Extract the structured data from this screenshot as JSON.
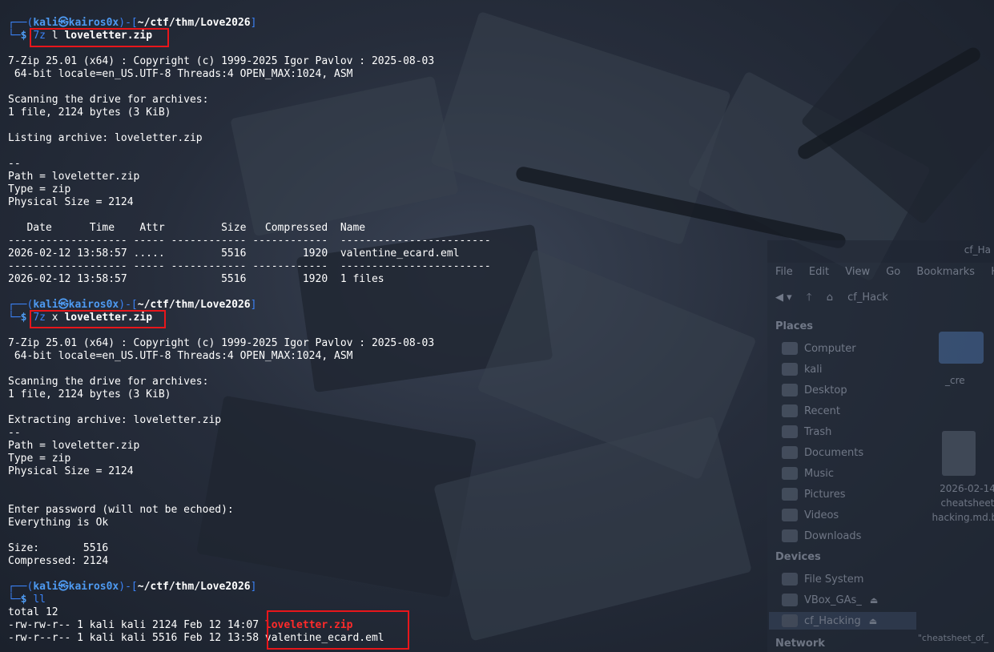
{
  "prompt": {
    "user": "kali",
    "host": "kairos0x",
    "path": "~/ctf/thm/Love2026",
    "symbol": "$"
  },
  "commands": [
    {
      "bin": "7z",
      "args": "l",
      "target": "loveletter.zip"
    },
    {
      "bin": "7z",
      "args": "x",
      "target": "loveletter.zip"
    },
    {
      "bin": "ll"
    }
  ],
  "list_output": {
    "banner": "7-Zip 25.01 (x64) : Copyright (c) 1999-2025 Igor Pavlov : 2025-08-03",
    "banner2": " 64-bit locale=en_US.UTF-8 Threads:4 OPEN_MAX:1024, ASM",
    "scanning": "Scanning the drive for archives:",
    "scan_result": "1 file, 2124 bytes (3 KiB)",
    "listing": "Listing archive: loveletter.zip",
    "sep": "--",
    "path": "Path = loveletter.zip",
    "type": "Type = zip",
    "physical": "Physical Size = 2124",
    "table_header": "   Date      Time    Attr         Size   Compressed  Name",
    "rule": "------------------- ----- ------------ ------------  ------------------------",
    "row": "2026-02-12 13:58:57 .....         5516         1920  valentine_ecard.eml",
    "total": "2026-02-12 13:58:57               5516         1920  1 files"
  },
  "extract_output": {
    "banner": "7-Zip 25.01 (x64) : Copyright (c) 1999-2025 Igor Pavlov : 2025-08-03",
    "banner2": " 64-bit locale=en_US.UTF-8 Threads:4 OPEN_MAX:1024, ASM",
    "scanning": "Scanning the drive for archives:",
    "scan_result": "1 file, 2124 bytes (3 KiB)",
    "extracting": "Extracting archive: loveletter.zip",
    "sep": "--",
    "path": "Path = loveletter.zip",
    "type": "Type = zip",
    "physical": "Physical Size = 2124",
    "password": "Enter password (will not be echoed):",
    "ok": "Everything is Ok",
    "size": "Size:       5516",
    "compressed": "Compressed: 2124"
  },
  "ll_output": {
    "total": "total 12",
    "files": [
      {
        "meta": "-rw-rw-r-- 1 kali kali 2124 Feb 12 14:07 ",
        "name": "loveletter.zip"
      },
      {
        "meta": "-rw-r--r-- 1 kali kali 5516 Feb 12 13:58 ",
        "name": "valentine_ecard.eml"
      }
    ]
  },
  "file_manager": {
    "title": "cf_Ha",
    "menu": [
      "File",
      "Edit",
      "View",
      "Go",
      "Bookmarks",
      "He"
    ],
    "toolbar_path": "cf_Hack",
    "places_label": "Places",
    "places": [
      "Computer",
      "kali",
      "Desktop",
      "Recent",
      "Trash",
      "Documents",
      "Music",
      "Pictures",
      "Videos",
      "Downloads"
    ],
    "devices_label": "Devices",
    "devices": [
      "File System",
      "VBox_GAs_",
      "cf_Hacking"
    ],
    "network_label": "Network",
    "folder_label": "_cre",
    "doc_label": [
      "2026-02-14",
      "cheatsheet",
      "hacking.md.ba"
    ],
    "status": "\"cheatsheet_of_"
  },
  "colors": {
    "prompt_blue": "#3b82f6",
    "highlight_red": "#e8161b",
    "archive_red": "#ff2a2a"
  }
}
